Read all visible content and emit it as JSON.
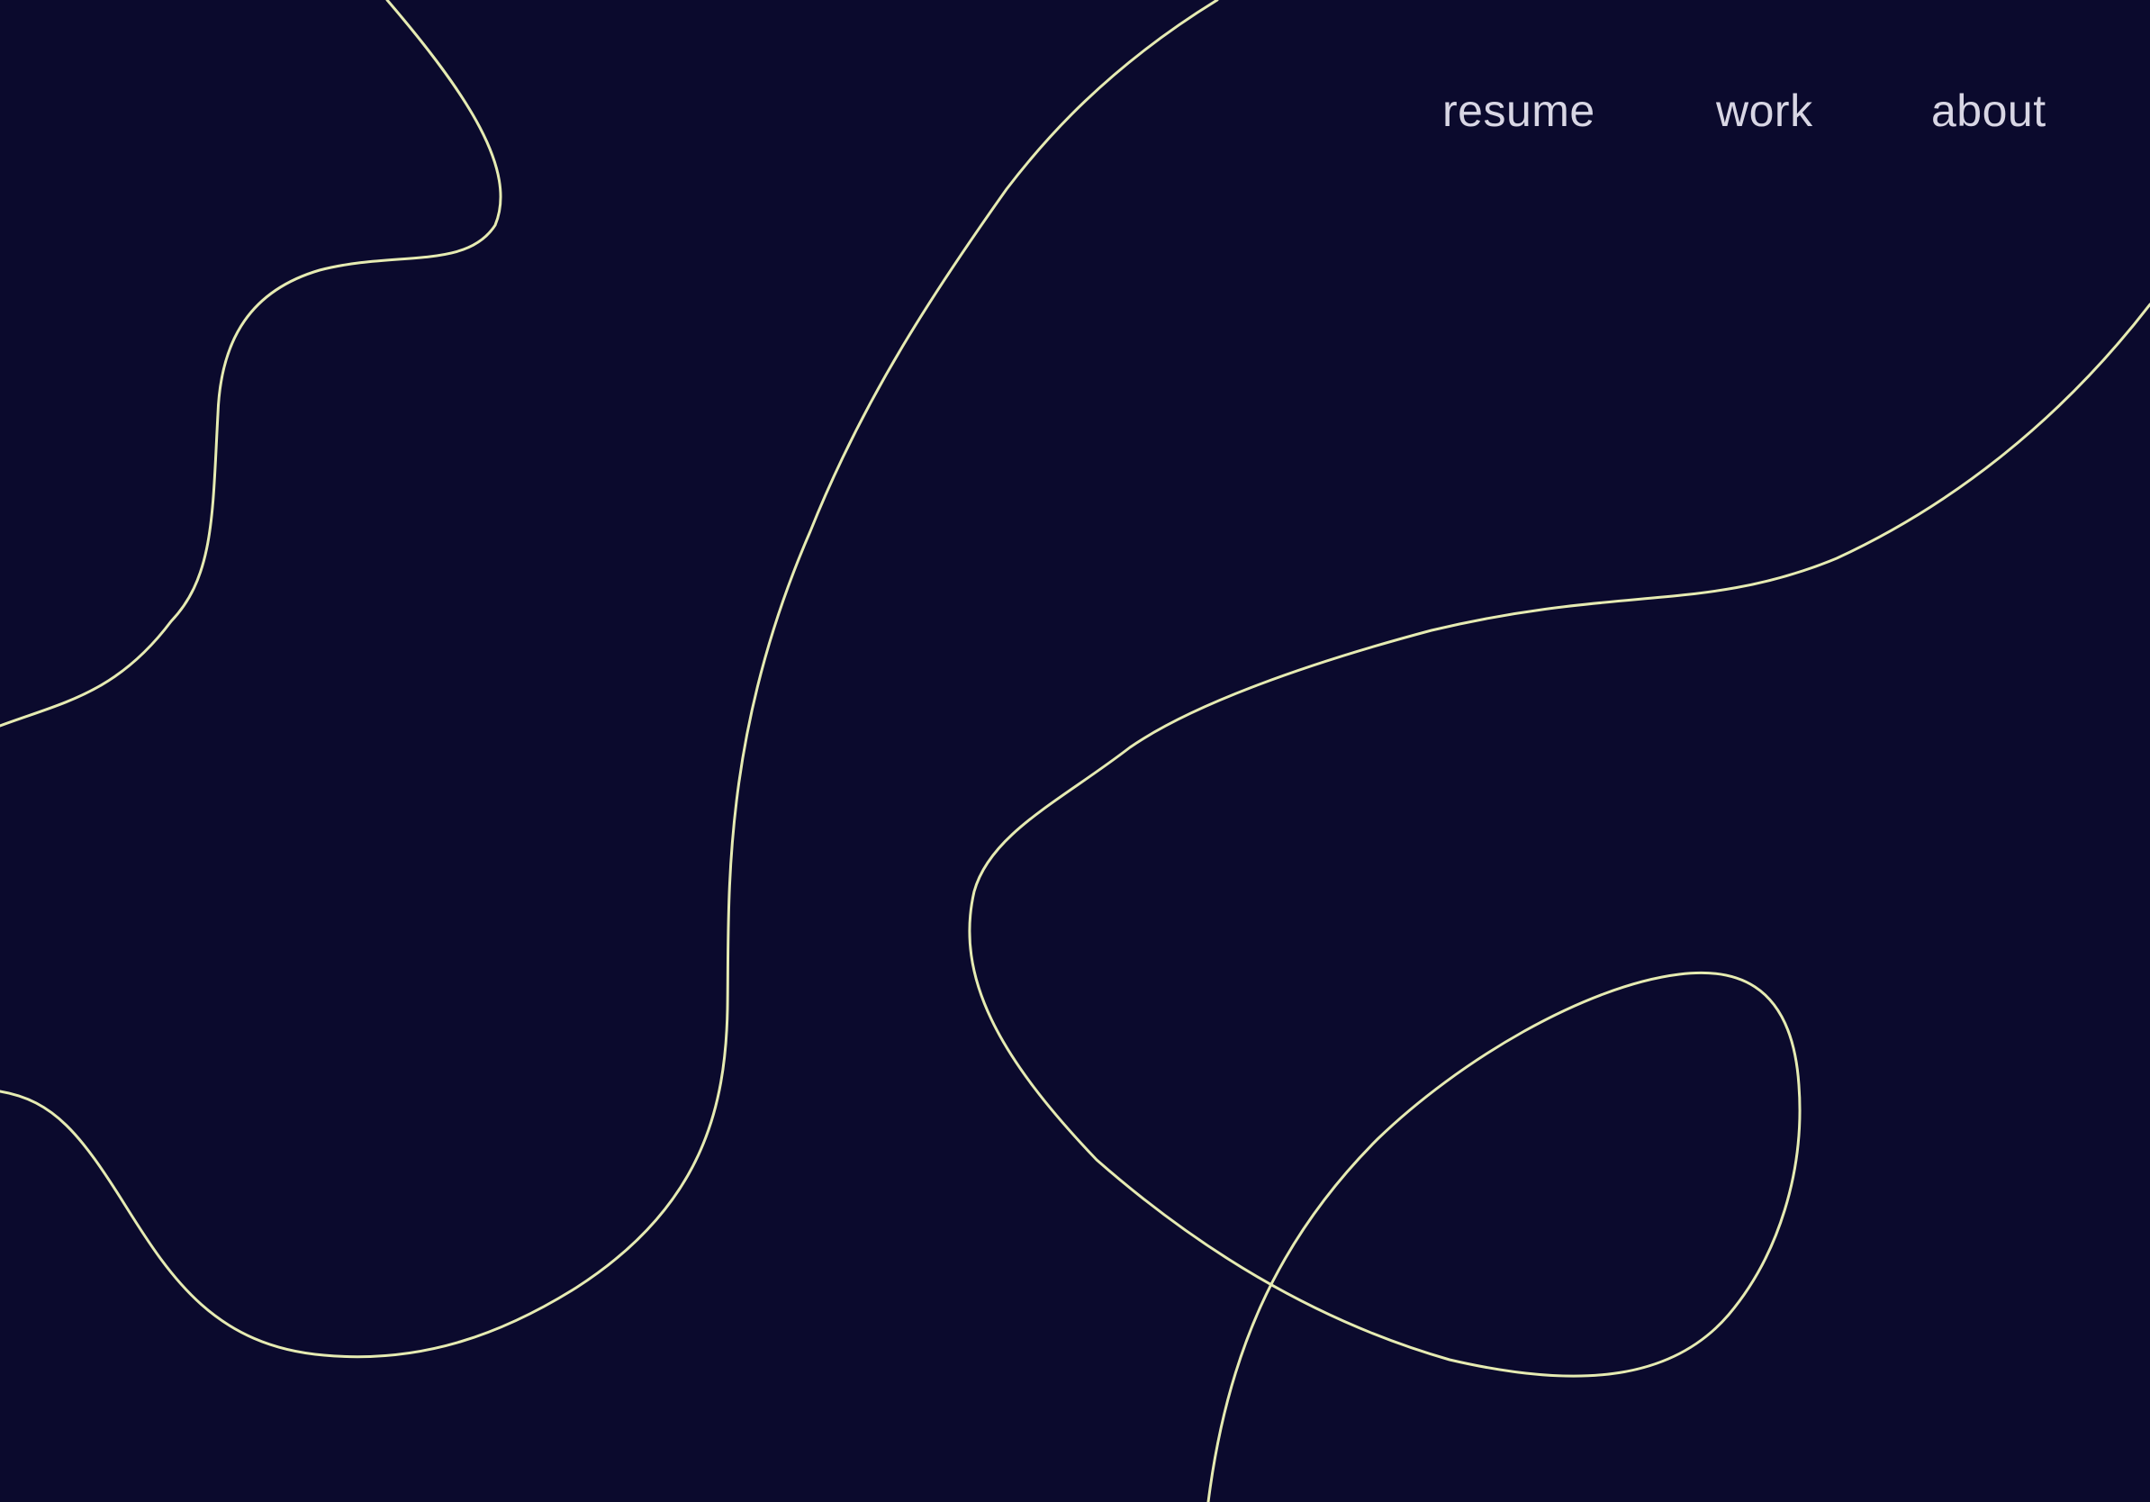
{
  "nav": {
    "items": [
      {
        "label": "resume"
      },
      {
        "label": "work"
      },
      {
        "label": "about"
      }
    ]
  },
  "colors": {
    "background": "#0b0a2d",
    "line": "#e6ebb2",
    "nav_text": "#d8d6e4"
  }
}
